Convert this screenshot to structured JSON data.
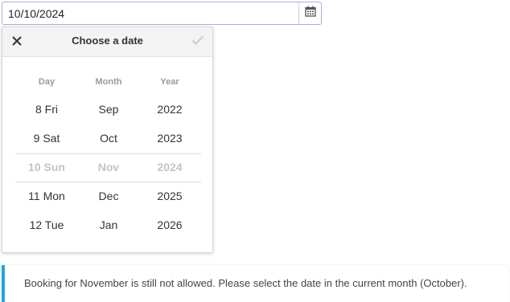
{
  "input": {
    "value": "10/10/2024",
    "icon": "calendar-icon"
  },
  "picker": {
    "title": "Choose a date",
    "close_icon": "close-icon",
    "confirm_icon": "check-icon",
    "headers": {
      "day": "Day",
      "month": "Month",
      "year": "Year"
    },
    "days": [
      "8 Fri",
      "9 Sat",
      "10 Sun",
      "11 Mon",
      "12 Tue"
    ],
    "months": [
      "Sep",
      "Oct",
      "Nov",
      "Dec",
      "Jan"
    ],
    "years": [
      "2022",
      "2023",
      "2024",
      "2025",
      "2026"
    ],
    "selected_row": 2
  },
  "notice": {
    "text": "Booking for November is still not allowed. Please select the date in the current month (October).",
    "accent_color": "#1ea7e1"
  }
}
